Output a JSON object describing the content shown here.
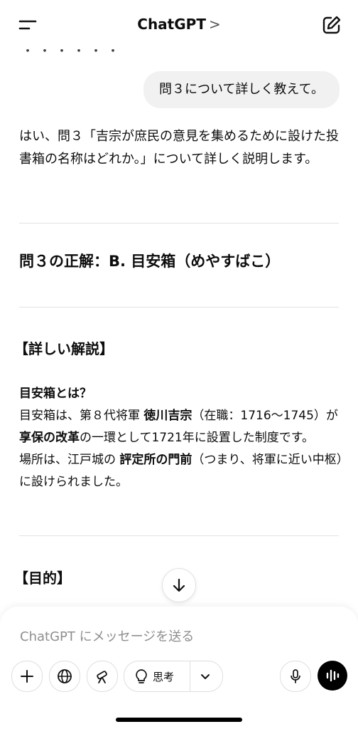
{
  "header": {
    "title": "ChatGPT",
    "chevron": ">",
    "menu_icon": "menu-icon",
    "new_chat_icon": "compose-icon"
  },
  "chat": {
    "cutoff_text": "・・・・・・",
    "user_message": "問３について詳しく教えて。",
    "intro": "はい、問３「吉宗が庶民の意見を集めるために設けた投書箱の名称はどれか。」について詳しく説明します。",
    "answer_heading": "問３の正解：B. 目安箱（めやすばこ）",
    "explanation_heading": "【詳しい解説】",
    "what_is_heading": "目安箱とは？",
    "detail": {
      "line1_a": "目安箱は、第８代将軍 ",
      "line1_b": "徳川吉宗",
      "line1_c": "（在職：1716〜1745）が",
      "line1_d": "享保の改革",
      "line1_e": "の一環として1721年に設置した制度です。",
      "line2_a": "場所は、江戸城の ",
      "line2_b": "評定所の門前",
      "line2_c": "（つまり、将軍に近い中枢）に設けられました。"
    },
    "purpose_heading": "【目的】"
  },
  "composer": {
    "placeholder": "ChatGPT にメッセージを送る",
    "think_label": "思考"
  }
}
